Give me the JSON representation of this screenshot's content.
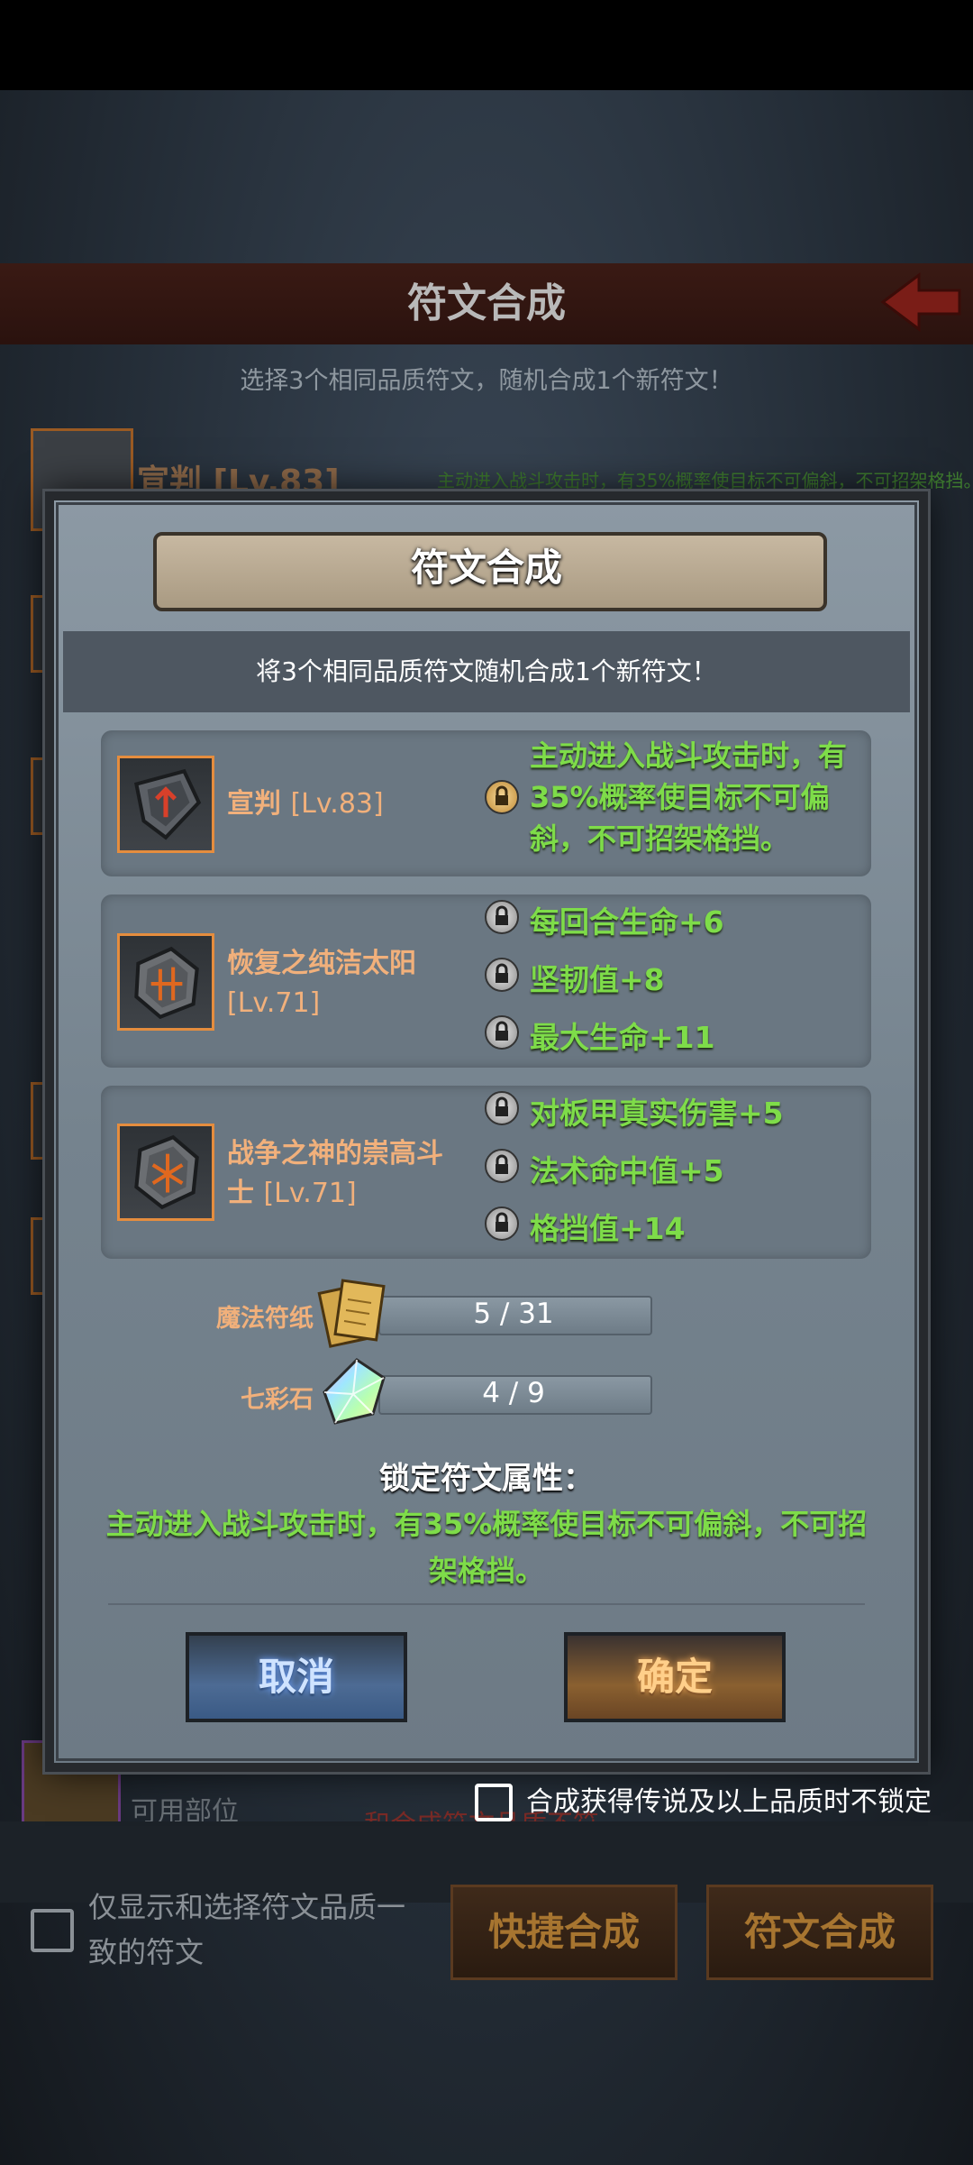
{
  "background": {
    "header_title": "符文合成",
    "subtitle": "选择3个相同品质符文，随机合成1个新符文！",
    "item_name": "宣判 [Lv.83]",
    "item_desc": "主动进入战斗攻击时，有35%概率使目标不可偏斜，不可招架格挡。",
    "bottom_parts_label": "可用部位",
    "bottom_red_text": "和合成符文品质不符",
    "only_show_same_quality": "仅显示和选择符文品质一致的符文",
    "quick_synth_button": "快捷合成",
    "rune_synth_button": "符文合成"
  },
  "modal": {
    "title": "符文合成",
    "instruction": "将3个相同品质符文随机合成1个新符文！",
    "runes": [
      {
        "icon": "verdict-rune-icon",
        "name": "宣判",
        "level": "[Lv.83]",
        "locked": true,
        "attrs": [
          "主动进入战斗攻击时，有35%概率使目标不可偏斜，不可招架格挡。"
        ]
      },
      {
        "icon": "sun-rune-icon",
        "name": "恢复之纯洁太阳",
        "level": "[Lv.71]",
        "locked": false,
        "attrs": [
          "每回合生命+6",
          "坚韧值+8",
          "最大生命+11"
        ]
      },
      {
        "icon": "war-god-rune-icon",
        "name": "战争之神的崇高斗士",
        "level": "[Lv.71]",
        "locked": false,
        "attrs": [
          "对板甲真实伤害+5",
          "法术命中值+5",
          "格挡值+14"
        ]
      }
    ],
    "materials": [
      {
        "label": "魔法符纸",
        "icon": "paper-scroll-icon",
        "count": "5 / 31",
        "progress": 0.16
      },
      {
        "label": "七彩石",
        "icon": "rainbow-crystal-icon",
        "count": "4 / 9",
        "progress": 0.44
      }
    ],
    "lock_title": "锁定符文属性：",
    "lock_desc": "主动进入战斗攻击时，有35%概率使目标不可偏斜，不可招架格挡。",
    "cancel_button": "取消",
    "confirm_button": "确定",
    "legendary_no_lock_option": "合成获得传说及以上品质时不锁定"
  },
  "colors": {
    "accent_orange": "#e58d3e",
    "attr_green": "#7edc49",
    "rune_name": "#f1b07b"
  }
}
